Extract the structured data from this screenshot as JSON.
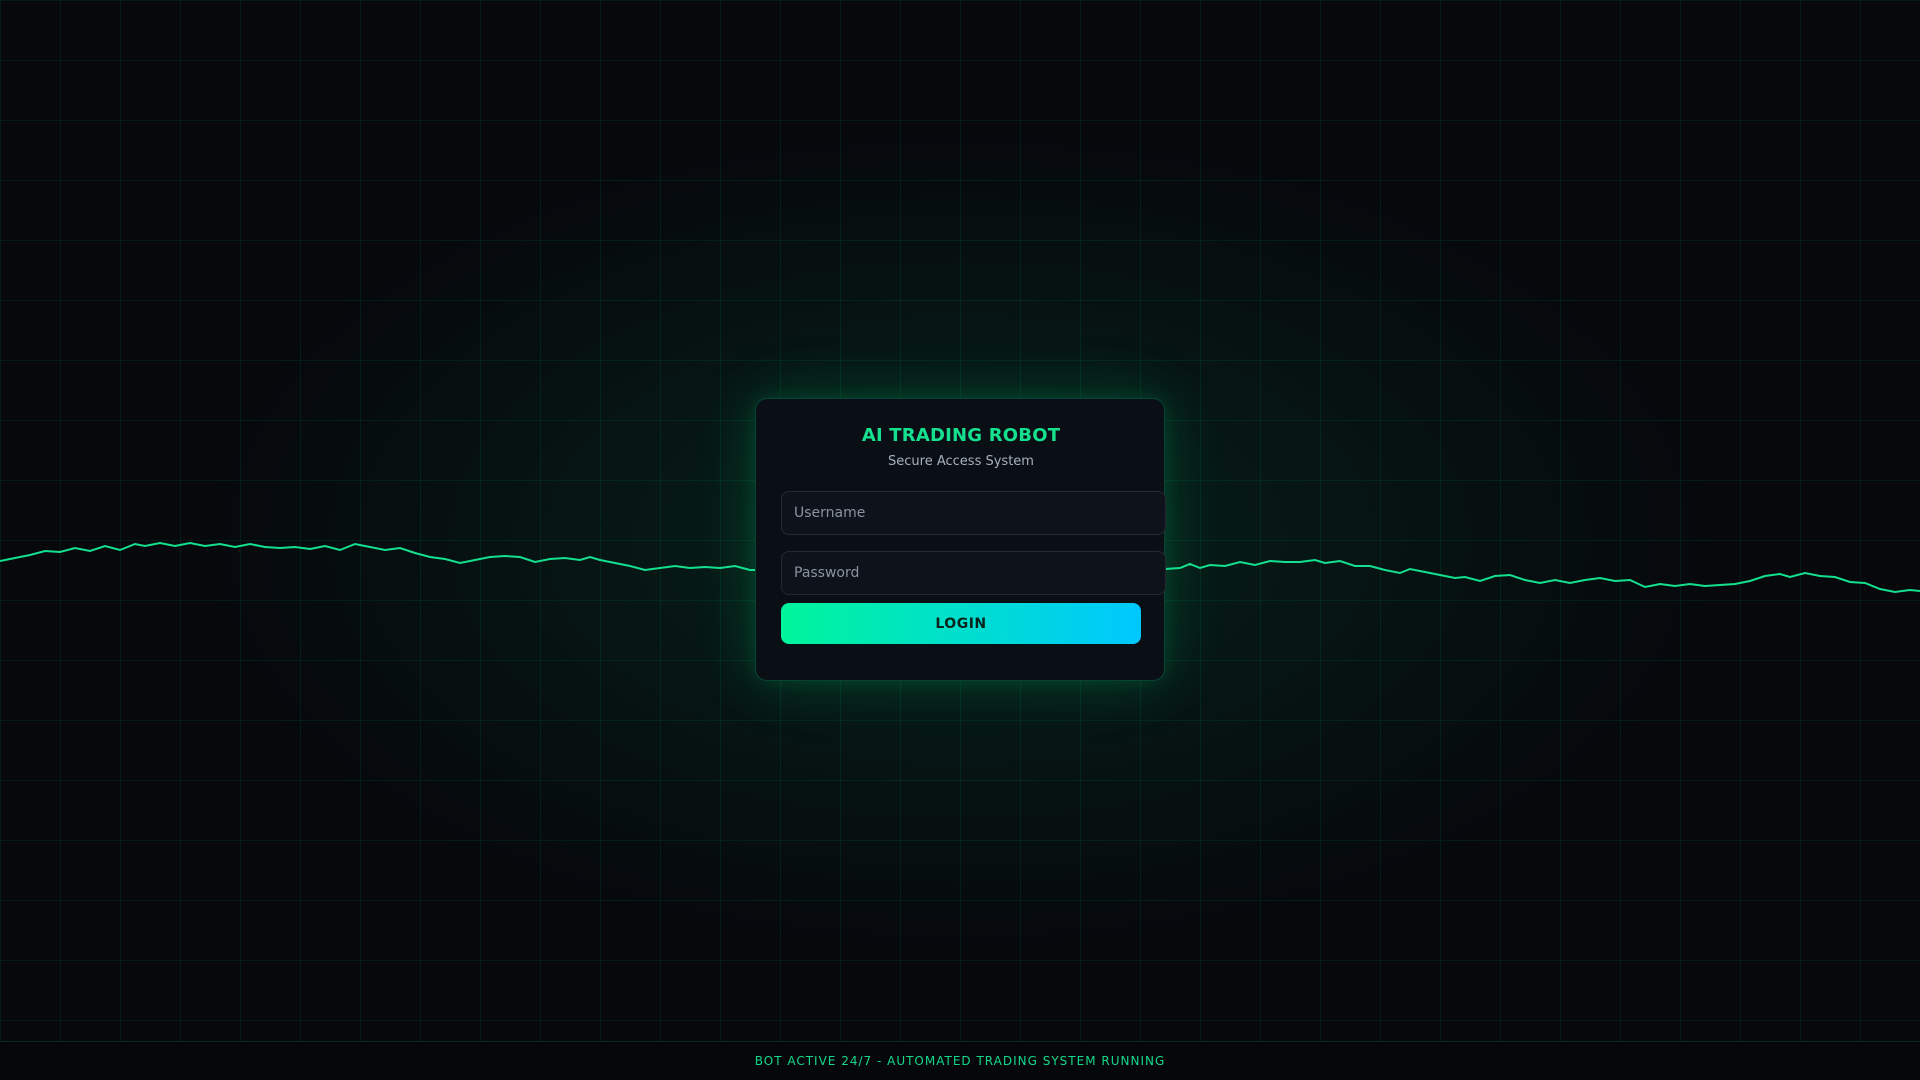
{
  "login_card": {
    "title": "AI TRADING ROBOT",
    "subtitle": "Secure Access System",
    "username_placeholder": "Username",
    "password_placeholder": "Password",
    "login_label": "LOGIN"
  },
  "footer": {
    "status_text": "BOT ACTIVE 24/7 - AUTOMATED TRADING SYSTEM RUNNING"
  },
  "colors": {
    "accent": "#14e08e",
    "button_gradient_start": "#00f59b",
    "button_gradient_end": "#00c8ff",
    "background": "#06080c"
  }
}
